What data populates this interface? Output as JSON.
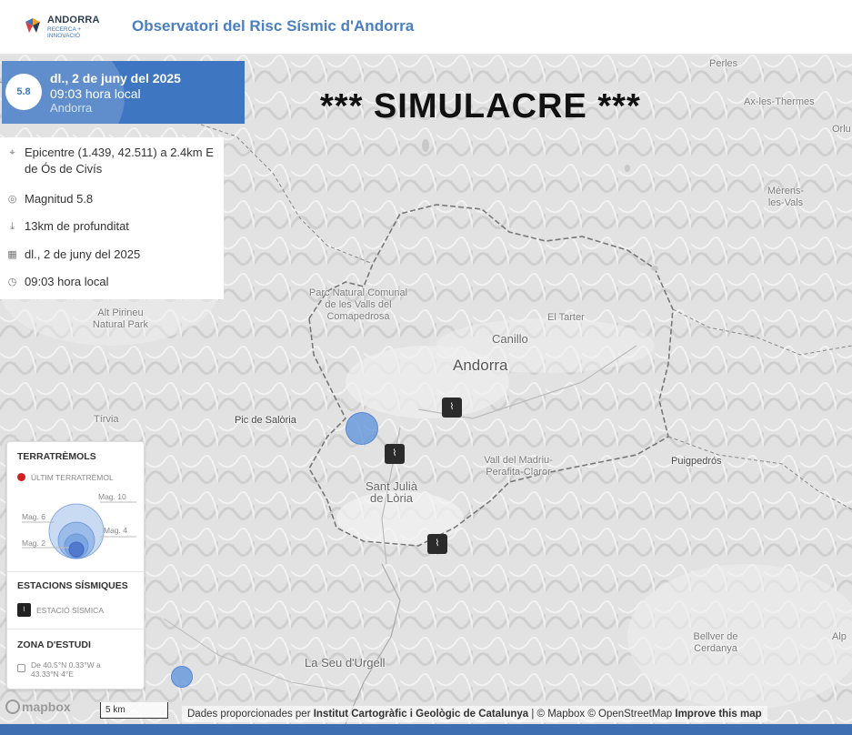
{
  "header": {
    "logo_title": "ANDORRA",
    "logo_subtitle": "RECERCA + INNOVACIÓ",
    "site_title": "Observatori del Risc Sísmic d'Andorra"
  },
  "banner": "*** SIMULACRE ***",
  "event": {
    "magnitude_badge": "5.8",
    "date": "dl., 2 de juny del 2025",
    "time": "09:03 hora local",
    "region": "Andorra"
  },
  "details": {
    "epicentre": "Epicentre (1.439, 42.511) a 2.4km E de Ós de Civís",
    "magnitude": "Magnitud 5.8",
    "depth": "13km de profunditat",
    "date": "dl., 2 de juny del 2025",
    "time": "09:03 hora local"
  },
  "places": {
    "perles": "Perles",
    "ax": "Ax-les-Thermes",
    "orlu": "Orlu",
    "merens": "Mérens-les-Vals",
    "parc_natural": "Parc Natural Comunal de les Valls del Comapedrosa",
    "alt_pirineu": "Alt Pirineu Natural Park",
    "el_tarter": "El Tarter",
    "canillo": "Canillo",
    "andorra": "Andorra",
    "tirvia": "Tírvia",
    "pic_saloria": "Pic de Salòria",
    "puigpedros": "Puigpedrós",
    "vall_madriu": "Vall del Madriu-Perafita-Claror",
    "sant_julia": "Sant Julià de Lòria",
    "bellver": "Bellver de Cerdanya",
    "seu_urgell": "La Seu d'Urgell",
    "alp": "Alp"
  },
  "legend": {
    "quakes_title": "TERRATRÈMOLS",
    "last_quake": "ÚLTIM TERRATRÈMOL",
    "mag10": "Mag. 10",
    "mag6": "Mag. 6",
    "mag4": "Mag. 4",
    "mag2": "Mag. 2",
    "stations_title": "ESTACIONS SÍSMIQUES",
    "station_label": "ESTACIÓ SÍSMICA",
    "zone_title": "ZONA D'ESTUDI",
    "zone_text": "De 40.5°N 0.33°W a 43.33°N 4°E"
  },
  "map_footer": {
    "mapbox": "mapbox",
    "scale": "5 km",
    "attribution_prefix": "Dades proporcionades per",
    "attribution_icgc": "Institut Cartogràfic i Geològic de Catalunya",
    "attribution_rest": "| © Mapbox © OpenStreetMap",
    "improve": "Improve this map"
  },
  "colors": {
    "brand_blue": "#3e76c2",
    "title_blue": "#4a7fc0",
    "quake_fill": "#6496dc",
    "last_quake_red": "#d42020"
  }
}
